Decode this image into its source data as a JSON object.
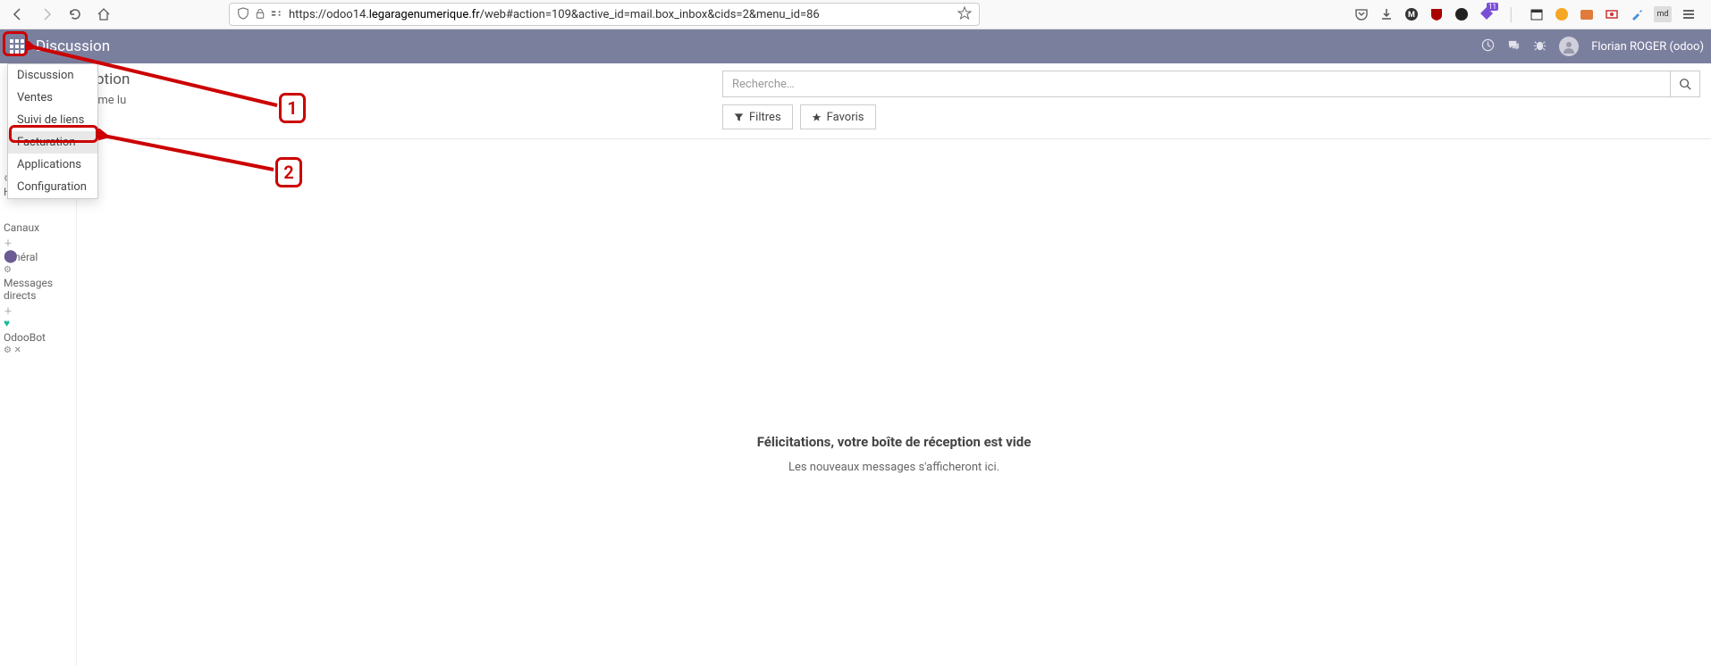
{
  "browser": {
    "url_prefix": "https://odoo14.",
    "url_domain": "legaragenumerique.fr",
    "url_path": "/web#action=109&active_id=mail.box_inbox&cids=2&menu_id=86",
    "ext_badge": "11"
  },
  "topbar": {
    "title": "Discussion",
    "username": "Florian ROGER (odoo)"
  },
  "apps_menu": {
    "items": [
      {
        "label": "Discussion"
      },
      {
        "label": "Ventes"
      },
      {
        "label": "Suivi de liens"
      },
      {
        "label": "Facturation"
      },
      {
        "label": "Applications"
      },
      {
        "label": "Configuration"
      }
    ]
  },
  "sidebar": {
    "inbox_suffix": "eption",
    "mark_read_suffix": "mme lu",
    "historique": "Historique",
    "canaux": "Canaux",
    "general_suffix": "néral",
    "messages_directs": "Messages directs",
    "odoobot": "OdooBot"
  },
  "search": {
    "placeholder": "Recherche…",
    "filters_label": "Filtres",
    "favoris_label": "Favoris"
  },
  "empty": {
    "title": "Félicitations, votre boîte de réception est vide",
    "sub": "Les nouveaux messages s'afficheront ici."
  },
  "annotations": {
    "label1": "1",
    "label2": "2"
  }
}
